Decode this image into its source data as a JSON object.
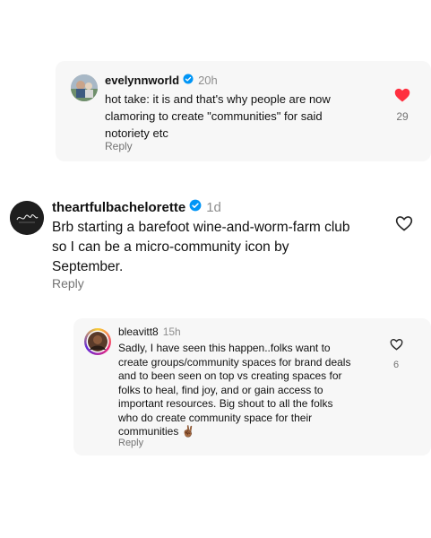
{
  "comments": [
    {
      "username": "evelynnworld",
      "verified": true,
      "time": "20h",
      "text": "hot take: it is and that's why people are now\nclamoring to create \"communities\" for said\nnotoriety etc",
      "reply_label": "Reply",
      "liked": true,
      "like_count": "29"
    },
    {
      "username": "theartfulbachelorette",
      "verified": true,
      "time": "1d",
      "text": "Brb starting a barefoot wine-and-worm-farm club\nso I can be a micro-community icon by\nSeptember.",
      "reply_label": "Reply",
      "liked": false,
      "like_count": ""
    },
    {
      "username": "bleavitt8",
      "verified": false,
      "time": "15h",
      "text": "Sadly, I have seen this happen..folks want to\ncreate groups/community  spaces for brand deals\nand to been seen on top vs creating spaces for\nfolks to heal, find joy, and or gain access to\nimportant resources.  Big shout to all the folks\nwho do create community space for their\ncommunities ✌🏾",
      "reply_label": "Reply",
      "liked": false,
      "like_count": "6"
    }
  ],
  "colors": {
    "card_bg": "#f7f7f7",
    "verified_blue": "#0095f6",
    "like_red": "#ff3040",
    "secondary_text": "#737373"
  }
}
